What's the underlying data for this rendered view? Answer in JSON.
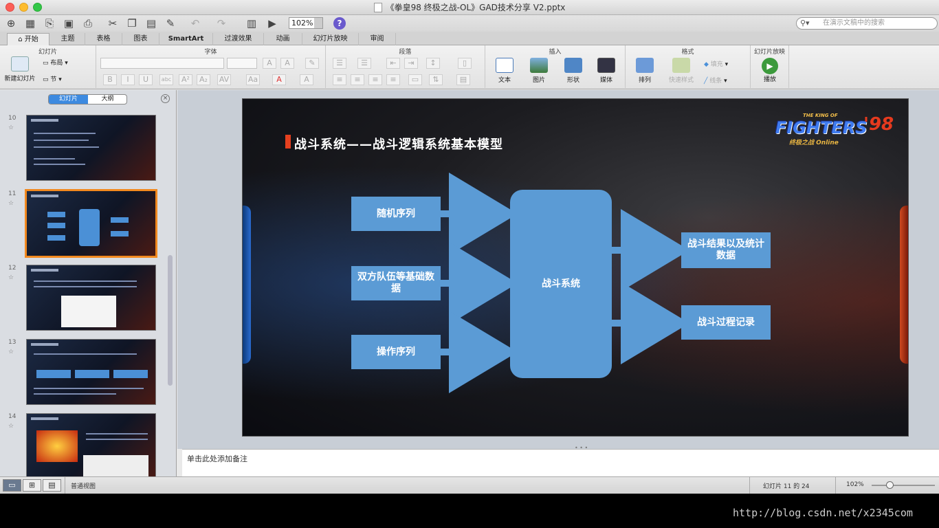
{
  "window": {
    "title": "《拳皇98 终极之战-OL》GAD技术分享 V2.pptx"
  },
  "toolbar": {
    "zoom": "102%",
    "search_placeholder": "在演示文稿中的搜索",
    "help": "?"
  },
  "tabs": [
    "开始",
    "主题",
    "表格",
    "图表",
    "SmartArt",
    "过渡效果",
    "动画",
    "幻灯片放映",
    "审阅"
  ],
  "ribbon": {
    "slides_group": "幻灯片",
    "new_slide": "新建幻灯片",
    "layout": "布局",
    "section": "节",
    "font_group": "字体",
    "paragraph_group": "段落",
    "insert_group": "插入",
    "text": "文本",
    "picture": "图片",
    "shape": "形状",
    "media": "媒体",
    "format_group": "格式",
    "arrange": "排列",
    "quick_styles": "快速样式",
    "fill": "填充",
    "line": "线条",
    "slideshow_group": "幻灯片放映",
    "play": "播放"
  },
  "sidebar": {
    "tab_slides": "幻灯片",
    "tab_outline": "大纲",
    "thumbnails": [
      {
        "num": "10"
      },
      {
        "num": "11"
      },
      {
        "num": "12"
      },
      {
        "num": "13"
      },
      {
        "num": "14"
      }
    ]
  },
  "slide": {
    "title": "战斗系统——战斗逻辑系统基本模型",
    "logo": {
      "top": "THE KING OF",
      "main": "FIGHTERS",
      "num": "'98",
      "sub": "终极之战 Online"
    },
    "nodes": {
      "random_seq": "随机序列",
      "team_data": "双方队伍等基础数据",
      "op_seq": "操作序列",
      "battle_system": "战斗系统",
      "result_stats": "战斗结果以及统计数据",
      "process_log": "战斗过程记录"
    }
  },
  "notes": {
    "placeholder": "单击此处添加备注"
  },
  "status": {
    "view": "普通视图",
    "slide_pos": "幻灯片 11 的 24",
    "zoom": "102%"
  },
  "watermark": "http://blog.csdn.net/x2345com"
}
